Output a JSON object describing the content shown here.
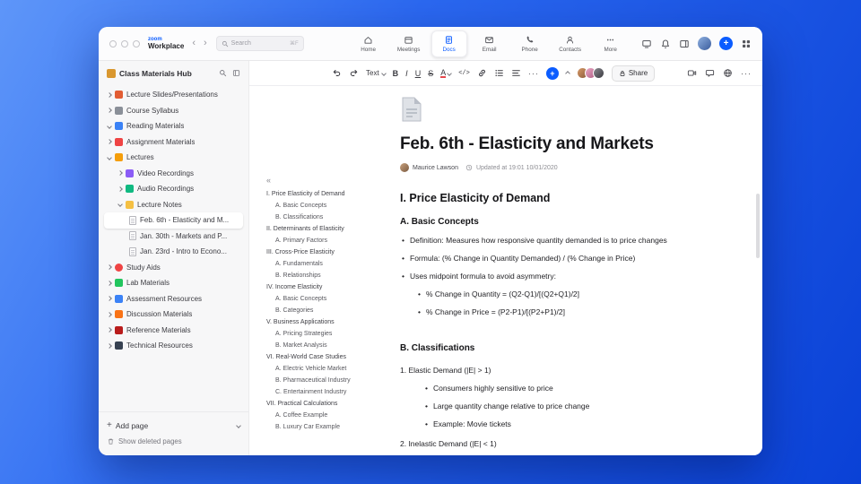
{
  "accent": "#0b5cff",
  "glyphs": {
    "back": "‹",
    "forward": "›",
    "more": "···",
    "collapse_outline": "«",
    "plus": "+"
  },
  "titlebar": {
    "brand_top": "zoom",
    "brand_bottom": "Workplace",
    "search_placeholder": "Search",
    "search_shortcut": "⌘F",
    "tabs": [
      {
        "label": "Home"
      },
      {
        "label": "Meetings"
      },
      {
        "label": "Docs"
      },
      {
        "label": "Email"
      },
      {
        "label": "Phone"
      },
      {
        "label": "Contacts"
      },
      {
        "label": "More"
      }
    ]
  },
  "sidebar": {
    "title": "Class Materials Hub",
    "items": [
      {
        "label": "Lecture Slides/Presentations"
      },
      {
        "label": "Course Syllabus"
      },
      {
        "label": "Reading Materials"
      },
      {
        "label": "Assignment Materials"
      },
      {
        "label": "Lectures"
      },
      {
        "label": "Video Recordings"
      },
      {
        "label": "Audio Recordings"
      },
      {
        "label": "Lecture Notes"
      },
      {
        "label": "Feb. 6th - Elasticity and M..."
      },
      {
        "label": "Jan. 30th - Markets and P..."
      },
      {
        "label": "Jan. 23rd - Intro to Econo..."
      },
      {
        "label": "Study Aids"
      },
      {
        "label": "Lab Materials"
      },
      {
        "label": "Assessment Resources"
      },
      {
        "label": "Discussion Materials"
      },
      {
        "label": "Reference Materials"
      },
      {
        "label": "Technical Resources"
      }
    ],
    "footer": {
      "add_page": "Add page",
      "show_deleted": "Show deleted pages"
    }
  },
  "toolbar": {
    "text_style": "Text",
    "bold": "B",
    "italic": "I",
    "underline": "U",
    "strikethrough": "S",
    "font_color": "A",
    "code": "</>",
    "share": "Share"
  },
  "doc": {
    "title": "Feb. 6th - Elasticity and Markets",
    "author": "Maurice Lawson",
    "updated": "Updated at 19:01 10/01/2020",
    "outline": [
      "I. Price Elasticity of Demand",
      "A. Basic Concepts",
      "B. Classifications",
      "II. Determinants of Elasticity",
      "A. Primary Factors",
      "III. Cross-Price Elasticity",
      "A. Fundamentals",
      "B. Relationships",
      "IV. Income Elasticity",
      "A. Basic Concepts",
      "B. Categories",
      "V. Business Applications",
      "A. Pricing Strategies",
      "B. Market Analysis",
      "VI. Real-World Case Studies",
      "A. Electric Vehicle Market",
      "B. Pharmaceutical Industry",
      "C. Entertainment Industry",
      "VII. Practical Calculations",
      "A. Coffee Example",
      "B. Luxury Car Example"
    ],
    "h1": "I. Price Elasticity of Demand",
    "sectionA": {
      "heading": "A. Basic Concepts",
      "b1": "Definition: Measures how responsive quantity demanded is to price changes",
      "b2": "Formula: (% Change in Quantity Demanded) / (% Change in Price)",
      "b3": "Uses midpoint formula to avoid asymmetry:",
      "n1": "% Change in Quantity = (Q2-Q1)/[(Q2+Q1)/2]",
      "n2": "% Change in Price = (P2-P1)/[(P2+P1)/2]"
    },
    "sectionB": {
      "heading": "B. Classifications",
      "item1": "1. Elastic Demand (|E| > 1)",
      "s1": "Consumers highly sensitive to price",
      "s2": "Large quantity change relative to price change",
      "s3": "Example: Movie tickets",
      "item2": "2. Inelastic Demand (|E| < 1)"
    }
  }
}
